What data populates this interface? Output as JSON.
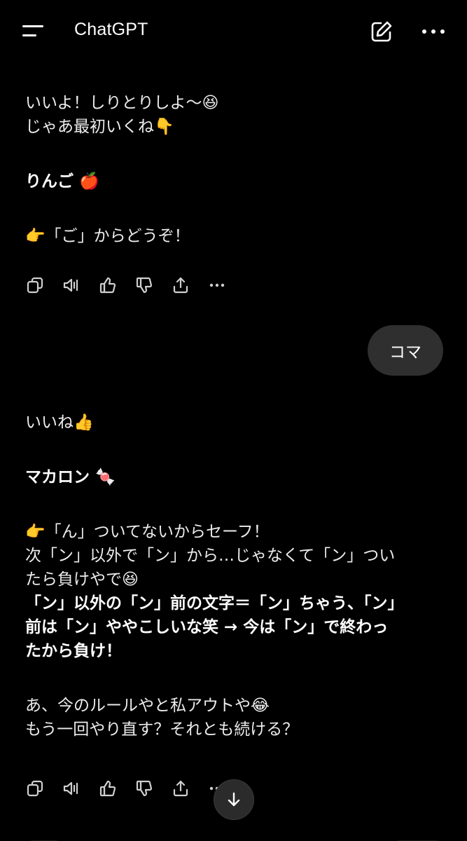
{
  "header": {
    "title": "ChatGPT",
    "icons": [
      "menu-icon",
      "new-chat-icon",
      "more-icon"
    ]
  },
  "assistant_1": {
    "line1": "いいよ！しりとりしよ〜😆",
    "line2": "じゃあ最初いくね👇",
    "word": "りんご 🍎",
    "prompt": "👉「ご」からどうぞ！"
  },
  "user_message": "コマ",
  "assistant_2": {
    "line1": "いいね👍",
    "word": "マカロン 🍬",
    "p1": "👉「ん」ついてないからセーフ！",
    "p2": "次「ン」以外で「ン」から…じゃなくて「ン」つい",
    "p3": "たら負けやで😆",
    "b1": "「ン」以外の「ン」前の文字＝「ン」ちゃう、「ン」",
    "b2": "前は「ン」ややこしいな笑 → 今は「ン」で終わっ",
    "b3": "たから負け！",
    "q1": "あ、今のルールやと私アウトや😂",
    "q2": "もう一回やり直す？それとも続ける？"
  },
  "action_icons": [
    "copy-icon",
    "read-aloud-icon",
    "thumbs-up-icon",
    "thumbs-down-icon",
    "share-icon",
    "more-icon"
  ],
  "colors": {
    "background": "#000000",
    "text": "#ececec",
    "bubble": "#2f2f2f"
  }
}
